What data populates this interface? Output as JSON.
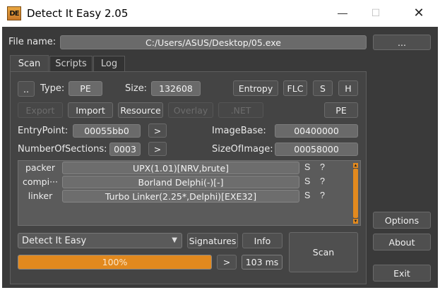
{
  "window": {
    "title": "Detect It Easy 2.05",
    "icon_text": "DE",
    "minimize": "—",
    "maximize": "☐",
    "close": "✕"
  },
  "file": {
    "label": "File name:",
    "path": "C:/Users/ASUS/Desktop/05.exe",
    "browse_label": "..."
  },
  "tabs": [
    {
      "label": "Scan",
      "active": true
    },
    {
      "label": "Scripts",
      "active": false
    },
    {
      "label": "Log",
      "active": false
    }
  ],
  "scan": {
    "up_button": "..",
    "type_label": "Type:",
    "type_value": "PE",
    "size_label": "Size:",
    "size_value": "132608",
    "entropy_button": "Entropy",
    "flc_button": "FLC",
    "s_button": "S",
    "h_button": "H",
    "export_button": "Export",
    "import_button": "Import",
    "resource_button": "Resource",
    "overlay_button": "Overlay",
    "net_button": ".NET",
    "pe_button": "PE",
    "entrypoint_label": "EntryPoint:",
    "entrypoint_value": "00055bb0",
    "imagebase_label": "ImageBase:",
    "imagebase_value": "00400000",
    "sections_label": "NumberOfSections:",
    "sections_value": "0003",
    "sizeofimage_label": "SizeOfImage:",
    "sizeofimage_value": "00058000",
    "go_arrow": ">"
  },
  "results": [
    {
      "type": "packer",
      "name": "UPX(1.01)[NRV,brute]",
      "s": "S",
      "q": "?"
    },
    {
      "type": "compi···",
      "name": "Borland Delphi(-)[-]",
      "s": "S",
      "q": "?"
    },
    {
      "type": "linker",
      "name": "Turbo Linker(2.25*,Delphi)[EXE32]",
      "s": "S",
      "q": "?"
    }
  ],
  "bottom": {
    "engine_selected": "Detect It Easy",
    "signatures_button": "Signatures",
    "info_button": "Info",
    "scan_button": "Scan",
    "progress_text": "100%",
    "progress_value": 1.0,
    "next_arrow": ">",
    "time_text": "103 ms"
  },
  "side": {
    "options_button": "Options",
    "about_button": "About",
    "exit_button": "Exit"
  },
  "colors": {
    "accent": "#e2891e",
    "background": "#3a3a3a"
  }
}
